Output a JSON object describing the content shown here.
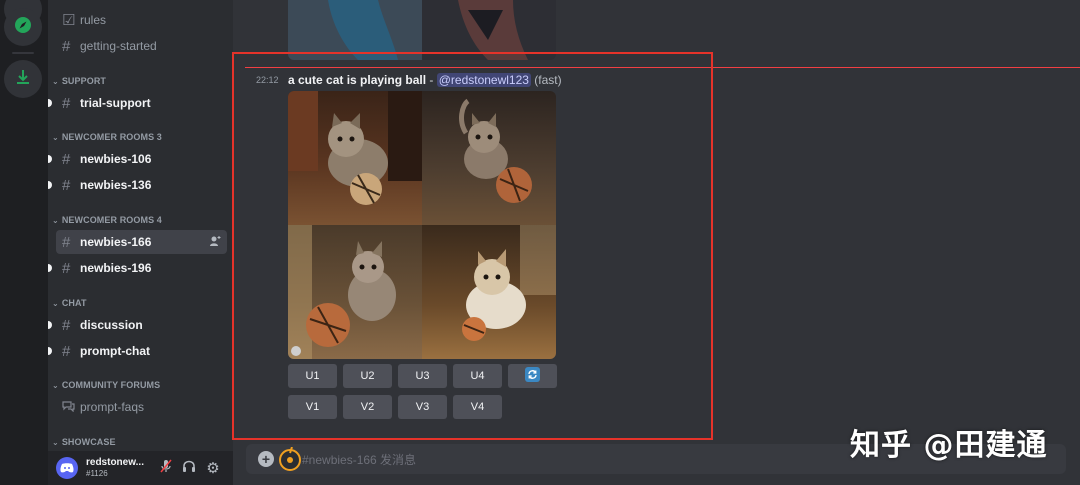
{
  "sidebar": {
    "channels_top": [
      {
        "label": "rules",
        "icon": "checkbox-icon"
      },
      {
        "label": "getting-started",
        "icon": "hash-icon"
      }
    ],
    "categories": {
      "support": "SUPPORT",
      "newcomer3": "NEWCOMER ROOMS 3",
      "newcomer4": "NEWCOMER ROOMS 4",
      "chat": "CHAT",
      "forums": "COMMUNITY FORUMS",
      "showcase": "SHOWCASE"
    },
    "channels": {
      "trial_support": "trial-support",
      "newbies_106": "newbies-106",
      "newbies_136": "newbies-136",
      "newbies_166": "newbies-166",
      "newbies_196": "newbies-196",
      "discussion": "discussion",
      "prompt_chat": "prompt-chat",
      "prompt_faqs": "prompt-faqs"
    }
  },
  "user": {
    "name": "redstonew...",
    "tag": "#1126"
  },
  "message": {
    "time": "22:12",
    "prompt": "a cute cat is playing ball",
    "separator": " - ",
    "mention": "@redstonewl123",
    "mode": "(fast)"
  },
  "buttons": {
    "upscale": [
      "U1",
      "U2",
      "U3",
      "U4"
    ],
    "variation": [
      "V1",
      "V2",
      "V3",
      "V4"
    ]
  },
  "composer": {
    "placeholder": "#newbies-166 发消息"
  },
  "watermark": "知乎 @田建通",
  "colors": {
    "accent": "#5865f2",
    "highlight": "#e5332a",
    "new_line": "#f23f43"
  }
}
